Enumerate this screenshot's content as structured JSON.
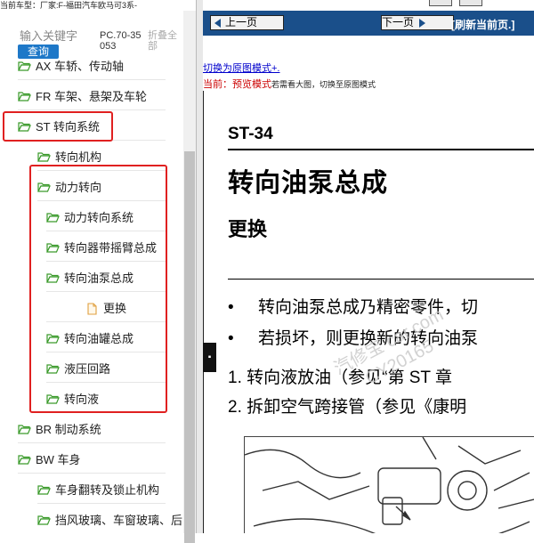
{
  "status_line": "当前车型：厂家:F-福田汽车欧马可3系-",
  "search": {
    "placeholder": "输入关键字",
    "query_button": "查询",
    "model_code": "PC.70-35053",
    "collapse_all": "折叠全部"
  },
  "tree": [
    {
      "label": "AX 车轿、传动轴",
      "icon": "folder-open-icon"
    },
    {
      "label": "FR 车架、悬架及车轮",
      "icon": "folder-open-icon"
    },
    {
      "label": "ST 转向系统",
      "icon": "folder-open-icon",
      "highlighted": true
    },
    {
      "label": "转向机构",
      "icon": "folder-open-icon"
    },
    {
      "label": "动力转向",
      "icon": "folder-open-icon"
    },
    {
      "label": "动力转向系统",
      "icon": "folder-open-icon"
    },
    {
      "label": "转向器带摇臂总成",
      "icon": "folder-open-icon"
    },
    {
      "label": "转向油泵总成",
      "icon": "folder-open-icon"
    },
    {
      "label": "更换",
      "icon": "document-icon"
    },
    {
      "label": "转向油罐总成",
      "icon": "folder-open-icon"
    },
    {
      "label": "液压回路",
      "icon": "folder-open-icon"
    },
    {
      "label": "转向液",
      "icon": "folder-open-icon"
    },
    {
      "label": "BR 制动系统",
      "icon": "folder-open-icon"
    },
    {
      "label": "BW 车身",
      "icon": "folder-open-icon"
    },
    {
      "label": "车身翻转及锁止机构",
      "icon": "folder-open-icon"
    },
    {
      "label": "挡风玻璃、车窗玻璃、后",
      "icon": "folder-open-icon"
    }
  ],
  "toolbar": {
    "prev_label": "上一页",
    "next_label": "下一页",
    "refresh_label": "[刷新当前页.]"
  },
  "doc": {
    "switch_link": "切换为原图模式+.",
    "mode_prefix": "当前：",
    "mode_value": "预览模式",
    "mode_hint": "若需看大图，切换至原图模式",
    "page_id": "ST-34",
    "page_title": "转向油泵总成",
    "section_title": "更换",
    "bullets": [
      "转向油泵总成乃精密零件，切",
      "若损坏，则更换新的转向油泵"
    ],
    "steps": [
      "1. 转向液放油（参见“第 ST 章",
      "2. 拆卸空气跨接管（参见《康明"
    ],
    "watermark": "汽修宝 car.com CY20165"
  },
  "colors": {
    "toolbar_bg": "#1a4f8a",
    "highlight_border": "#e02020",
    "folder_green": "#3a9a2a",
    "query_button_bg": "#1e78c8",
    "link_blue": "#0000cc",
    "mode_red": "#cc0000"
  }
}
